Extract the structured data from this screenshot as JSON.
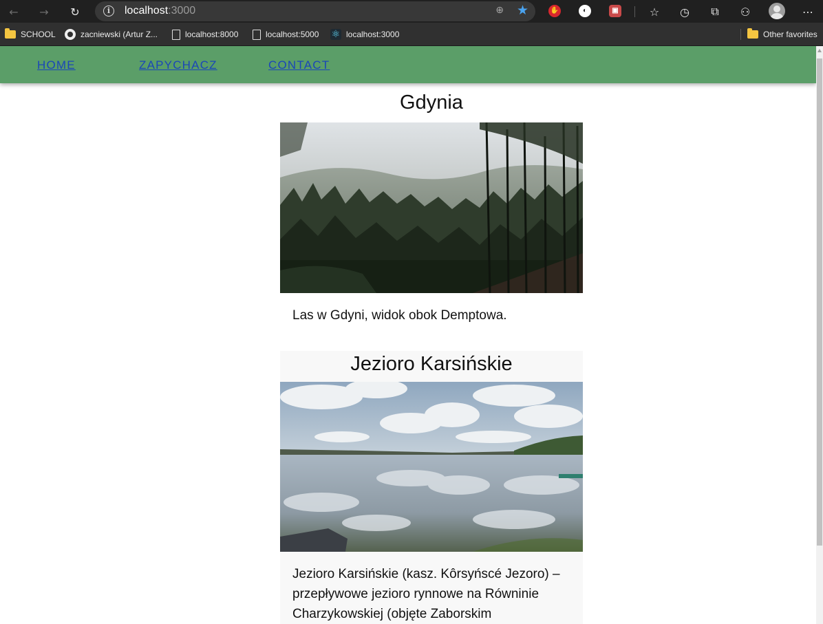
{
  "browser": {
    "url_host": "localhost",
    "url_port": ":3000",
    "bookmarks": [
      {
        "label": "SCHOOL"
      },
      {
        "label": "zacniewski (Artur Z..."
      },
      {
        "label": "localhost:8000"
      },
      {
        "label": "localhost:5000"
      },
      {
        "label": "localhost:3000"
      }
    ],
    "other_favorites": "Other favorites"
  },
  "nav": {
    "links": [
      "HOME",
      "ZAPYCHACZ",
      "CONTACT"
    ]
  },
  "cards": [
    {
      "title": "Gdynia",
      "description": "Las w Gdyni, widok obok Demptowa."
    },
    {
      "title": "Jezioro Karsińskie",
      "description": "Jezioro Karsińskie (kasz. Kôrsyńscé Jezoro) – przepływowe jezioro rynnowe na Równinie Charzykowskiej (objęte Zaborskim"
    }
  ],
  "colors": {
    "navbar": "#5b9e68",
    "link": "#1a46b8"
  }
}
